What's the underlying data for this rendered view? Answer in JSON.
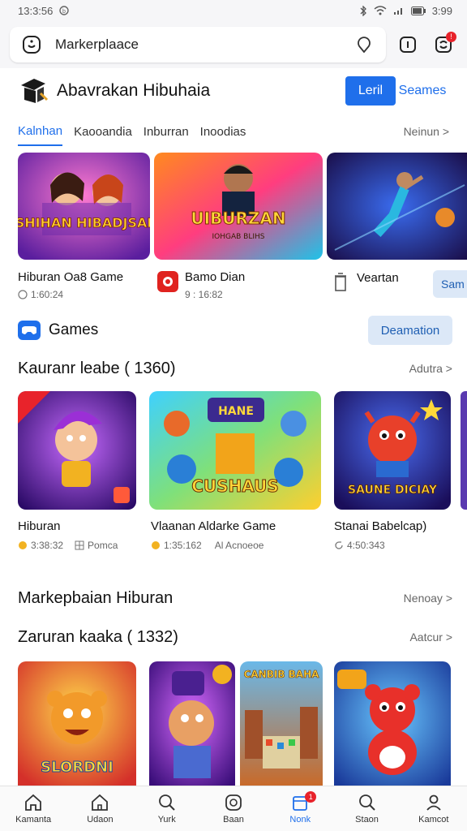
{
  "status_bar": {
    "time": "13:3:56",
    "battery": "3:99"
  },
  "search": {
    "value": "Markerplaace"
  },
  "header": {
    "title": "Abavrakan Hibuhaia",
    "primary_button": "Leril",
    "secondary_button": "Seames"
  },
  "tabs": {
    "items": [
      {
        "label": "Kalnhan",
        "active": true
      },
      {
        "label": "Kaooandia"
      },
      {
        "label": "Inburran"
      },
      {
        "label": "Inoodias"
      }
    ],
    "more": "Neinun >"
  },
  "featured": [
    {
      "title": "Hiburan Oa8 Game",
      "meta": "1:60:24",
      "art_text": "SHIHAN HIBADJSAI"
    },
    {
      "title": "Bamo Dian",
      "meta": "9 : 16:82",
      "art_text": "UIBURZAN",
      "art_sub": "IOHGAB BLIHS"
    },
    {
      "title": "Veartan",
      "button": "Sam"
    }
  ],
  "games_section": {
    "label": "Games",
    "button": "Deamation"
  },
  "section_a": {
    "title": "Kauranr leabe ( 1360)",
    "more": "Adutra >",
    "items": [
      {
        "title": "Hiburan",
        "meta": "3:38:32",
        "meta2": "Pomca"
      },
      {
        "title": "Vlaanan Aldarke Game",
        "meta": "1:35:162",
        "meta2": "Al Acnoeoe",
        "art_text": "CUSHAUS",
        "art_top": "HANE"
      },
      {
        "title": "Stanai Babelcap)",
        "meta": "4:50:343",
        "art_text": "SAUNE DICIAY"
      }
    ]
  },
  "section_b": {
    "title": "Markepbaian Hiburan",
    "more": "Nenoay >"
  },
  "section_c": {
    "title": "Zaruran kaaka ( 1332)",
    "more": "Aatcur >",
    "items": [
      {
        "art_text": "SLORDNI"
      },
      {
        "art_text": ""
      },
      {
        "art_text": "CANBIB BAHA"
      },
      {
        "art_text": ""
      }
    ]
  },
  "bottom_nav": [
    {
      "label": "Kamanta",
      "icon": "home-icon"
    },
    {
      "label": "Udaon",
      "icon": "home-outline-icon"
    },
    {
      "label": "Yurk",
      "icon": "search-icon"
    },
    {
      "label": "Baan",
      "icon": "chat-icon"
    },
    {
      "label": "Nonk",
      "icon": "calendar-icon",
      "active": true,
      "badge": "1"
    },
    {
      "label": "Staon",
      "icon": "search-alt-icon"
    },
    {
      "label": "Kamcot",
      "icon": "profile-icon"
    }
  ],
  "colors": {
    "accent": "#1f6feb",
    "badge": "#e8232b",
    "pill_bg": "#dce8f7"
  }
}
